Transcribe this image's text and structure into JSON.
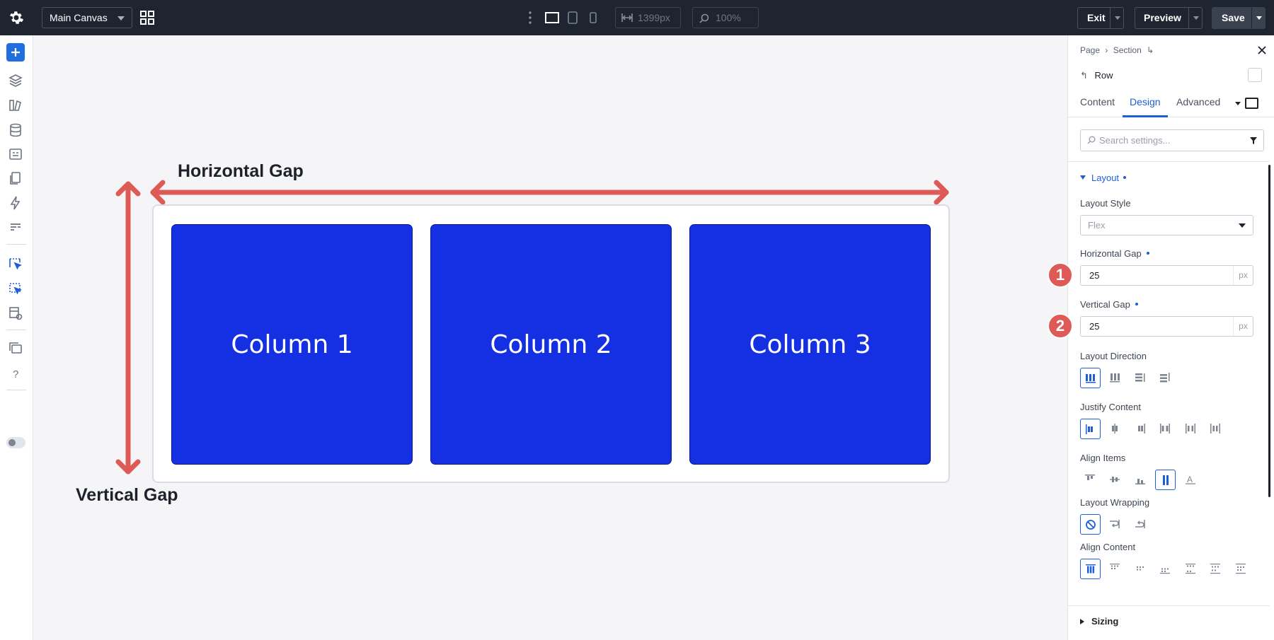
{
  "topbar": {
    "canvas_name": "Main Canvas",
    "width_value": "1399px",
    "zoom_value": "100%",
    "exit_label": "Exit",
    "preview_label": "Preview",
    "save_label": "Save"
  },
  "canvas": {
    "horizontal_gap_label": "Horizontal Gap",
    "vertical_gap_label": "Vertical Gap",
    "columns": [
      "Column 1",
      "Column 2",
      "Column 3"
    ],
    "arrow_color": "#de5a57",
    "column_color": "#1530e3"
  },
  "panel": {
    "breadcrumb": [
      "Page",
      "Section"
    ],
    "element_title": "Row",
    "tabs": [
      "Content",
      "Design",
      "Advanced"
    ],
    "active_tab": "Design",
    "search_placeholder": "Search settings...",
    "section_layout": "Layout",
    "layout_style_label": "Layout Style",
    "layout_style_value": "Flex",
    "horizontal_gap_label": "Horizontal Gap",
    "horizontal_gap_value": "25",
    "vertical_gap_label": "Vertical Gap",
    "vertical_gap_value": "25",
    "unit": "px",
    "badge_1": "1",
    "badge_2": "2",
    "layout_direction_label": "Layout Direction",
    "justify_content_label": "Justify Content",
    "align_items_label": "Align Items",
    "layout_wrapping_label": "Layout Wrapping",
    "align_content_label": "Align Content",
    "section_sizing": "Sizing",
    "accent_color": "#1f5fd6"
  }
}
